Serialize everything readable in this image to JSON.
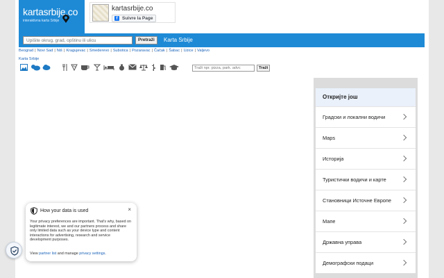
{
  "header": {
    "logo_title": "kartasrbije.co",
    "logo_subtitle": "interaktivna karta Srbije",
    "fb_page_name": "kartasrbije.co",
    "fb_button_label": "Suivre la Page"
  },
  "search": {
    "placeholder": "Upišite okrug, grad, opštinu ili ulicu",
    "button_label": "Pretraži",
    "bar_title": "Karta Srbije"
  },
  "city_links": [
    "Beograd",
    "Novi Sad",
    "Niš",
    "Kragujevac",
    "Smederevo",
    "Subotica",
    "Pozaravac",
    "Čačak",
    "Šabac",
    "Uzice",
    "Valjevo"
  ],
  "breadcrumb": "Karta Srbije",
  "poi_search": {
    "placeholder": "Traži npr. pizza, park. advc",
    "button_label": "Traži"
  },
  "category_icons": [
    "image-icon",
    "weather-icon",
    "cloud-icon",
    "restaurant-icon",
    "pizza-icon",
    "cafe-icon",
    "bar-icon",
    "hotel-icon",
    "bank-icon",
    "mail-icon",
    "court-icon",
    "pharmacy-icon",
    "fuel-icon",
    "education-icon"
  ],
  "discover": {
    "heading": "Откријте још",
    "items": [
      "Градски и локални водичи",
      "Maps",
      "Историја",
      "Туристички водичи и карте",
      "Становници Источне Европе",
      "Мапе",
      "Државна управа",
      "Демографски подаци"
    ]
  },
  "privacy": {
    "title": "How your data is used",
    "body": "Your privacy preferences are important. That's why, based on legitimate interest, we and our partners process and share only limited data such as your device type and content interactions for advertising, research and service development purposes.",
    "foot_prefix": "View ",
    "partner_link": "partner list",
    "foot_middle": " and manage ",
    "settings_link": "privacy settings",
    "foot_suffix": ".",
    "close_label": "×"
  }
}
